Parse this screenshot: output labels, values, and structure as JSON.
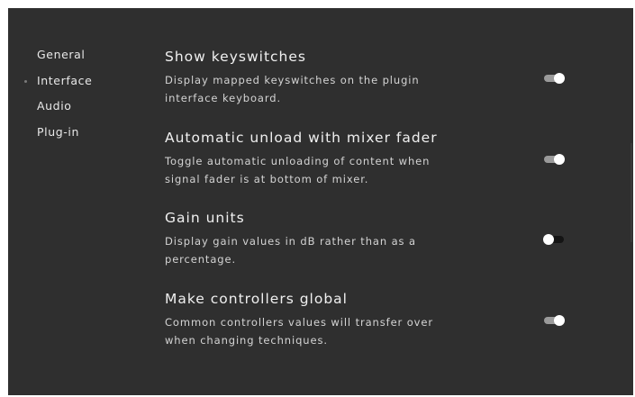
{
  "nav": {
    "items": [
      {
        "label": "General",
        "active": false
      },
      {
        "label": "Interface",
        "active": true
      },
      {
        "label": "Audio",
        "active": false
      },
      {
        "label": "Plug-in",
        "active": false
      }
    ]
  },
  "settings": [
    {
      "title": "Show keyswitches",
      "description": "Display mapped keyswitches on the plugin interface keyboard.",
      "enabled": true
    },
    {
      "title": "Automatic unload with mixer fader",
      "description": "Toggle automatic unloading of content when signal fader is at bottom of mixer.",
      "enabled": true
    },
    {
      "title": "Gain units",
      "description": "Display gain values in dB rather than as a percentage.",
      "enabled": false
    },
    {
      "title": "Make controllers global",
      "description": "Common controllers values will transfer over when changing techniques.",
      "enabled": true
    }
  ],
  "colors": {
    "panel_background": "#2f2f2f",
    "text": "#e6e6e6",
    "toggle_on_track": "#9a9a9a",
    "toggle_off_track": "#141414",
    "toggle_knob": "#ffffff"
  }
}
